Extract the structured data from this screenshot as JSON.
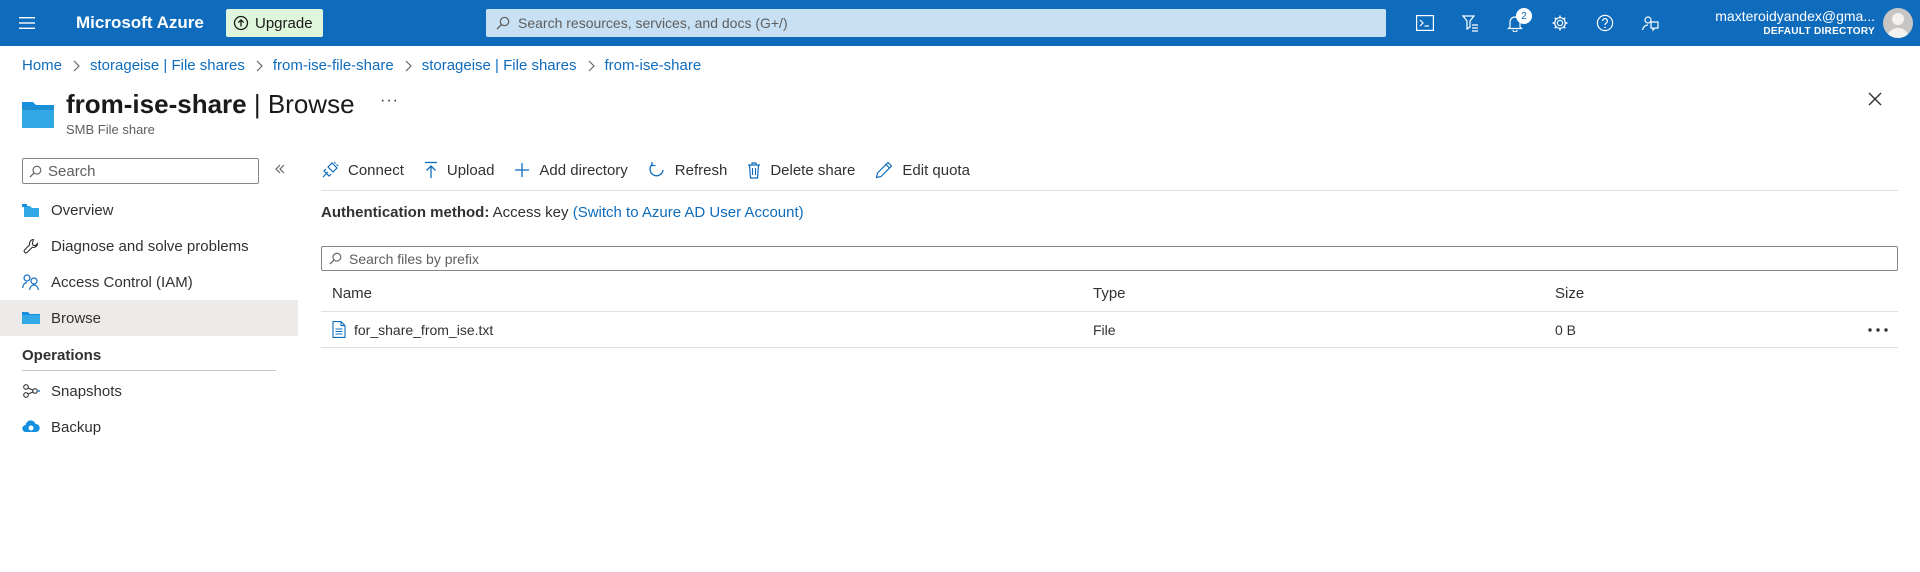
{
  "topbar": {
    "brand": "Microsoft Azure",
    "upgrade_label": "Upgrade",
    "search_placeholder": "Search resources, services, and docs (G+/)",
    "notification_count": "2",
    "user_email": "maxteroidyandex@gma...",
    "directory": "DEFAULT DIRECTORY",
    "icons": [
      "cloud-shell-icon",
      "directory-filter-icon",
      "notifications-icon",
      "settings-icon",
      "help-icon",
      "feedback-icon"
    ]
  },
  "breadcrumb": [
    "Home",
    "storageise | File shares",
    "from-ise-file-share",
    "storageise | File shares",
    "from-ise-share"
  ],
  "header": {
    "title_bold": "from-ise-share",
    "title_rest": " | Browse",
    "subtitle": "SMB File share",
    "more": "···"
  },
  "sidebar": {
    "search_placeholder": "Search",
    "items": [
      {
        "label": "Overview",
        "icon": "file-share-icon"
      },
      {
        "label": "Diagnose and solve problems",
        "icon": "wrench-icon"
      },
      {
        "label": "Access Control (IAM)",
        "icon": "people-icon"
      },
      {
        "label": "Browse",
        "icon": "folder-icon",
        "active": true
      }
    ],
    "section_operations": "Operations",
    "operations_items": [
      {
        "label": "Snapshots",
        "icon": "snapshot-icon"
      },
      {
        "label": "Backup",
        "icon": "backup-cloud-icon"
      }
    ]
  },
  "toolbar": {
    "connect": "Connect",
    "upload": "Upload",
    "add_directory": "Add directory",
    "refresh": "Refresh",
    "delete_share": "Delete share",
    "edit_quota": "Edit quota"
  },
  "auth": {
    "label": "Authentication method:",
    "value": "Access key",
    "switch_link": "(Switch to Azure AD User Account)"
  },
  "files": {
    "search_placeholder": "Search files by prefix",
    "columns": {
      "name": "Name",
      "type": "Type",
      "size": "Size"
    },
    "rows": [
      {
        "name": "for_share_from_ise.txt",
        "type": "File",
        "size": "0 B"
      }
    ]
  },
  "colors": {
    "topbar_bg": "#0f6cbd",
    "link": "#0f6cbd",
    "upgrade_bg": "#dff6dd",
    "nav_active_bg": "#edebe9"
  }
}
